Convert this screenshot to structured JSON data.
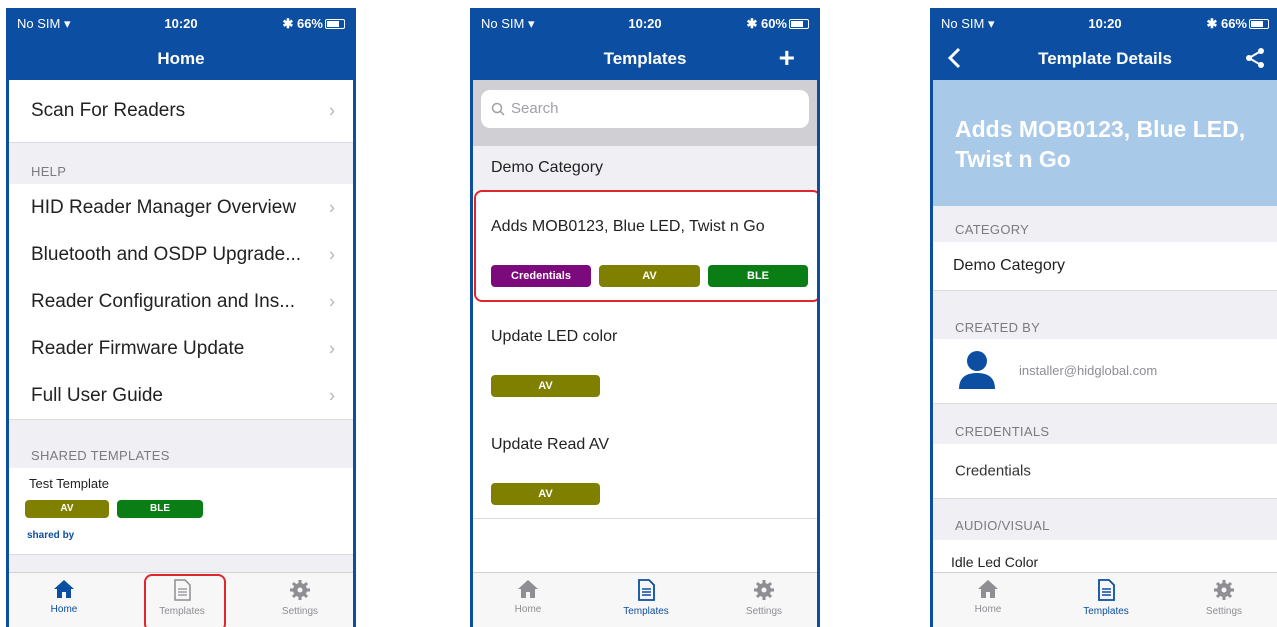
{
  "status": {
    "carrier": "No SIM ▾",
    "time": "10:20",
    "battery_1": "✱ 66%",
    "battery_2": "✱ 60%",
    "battery_3": "✱ 66%"
  },
  "screen1": {
    "title": "Home",
    "scan_item": "Scan For Readers",
    "help_header": "HELP",
    "help_items": [
      "HID Reader Manager Overview",
      "Bluetooth and OSDP Upgrade...",
      "Reader Configuration and Ins...",
      "Reader Firmware Update",
      "Full User Guide"
    ],
    "shared_header": "SHARED TEMPLATES",
    "shared_template": {
      "name": "Test Template",
      "tags": [
        "AV",
        "BLE"
      ],
      "shared_by": "shared by"
    }
  },
  "screen2": {
    "title": "Templates",
    "add_label": "+",
    "search_placeholder": "Search",
    "category": "Demo Category",
    "templates": [
      {
        "name": "Adds MOB0123, Blue LED, Twist n Go",
        "tags": [
          "Credentials",
          "AV",
          "BLE"
        ]
      },
      {
        "name": "Update LED color",
        "tags": [
          "AV"
        ]
      },
      {
        "name": "Update Read AV",
        "tags": [
          "AV"
        ]
      }
    ]
  },
  "screen3": {
    "title": "Template Details",
    "hero_title": "Adds MOB0123, Blue LED, Twist n Go",
    "category_header": "CATEGORY",
    "category_value": "Demo Category",
    "created_header": "CREATED BY",
    "created_value": "installer@hidglobal.com",
    "credentials_header": "CREDENTIALS",
    "credentials_value": "Credentials",
    "audio_header": "AUDIO/VISUAL",
    "audio_value": "Idle Led Color"
  },
  "tabs": {
    "home": "Home",
    "templates": "Templates",
    "settings": "Settings"
  },
  "colors": {
    "brand": "#0b4ea2",
    "av": "#808000",
    "ble": "#0a7d14",
    "credentials": "#7d0a7d",
    "highlight": "#e0262c",
    "hero": "#a9c9e9"
  },
  "icons": {
    "home": "home-icon",
    "templates": "document-icon",
    "settings": "gear-icon",
    "back": "chevron-left-icon",
    "share": "share-icon",
    "user": "user-icon"
  }
}
